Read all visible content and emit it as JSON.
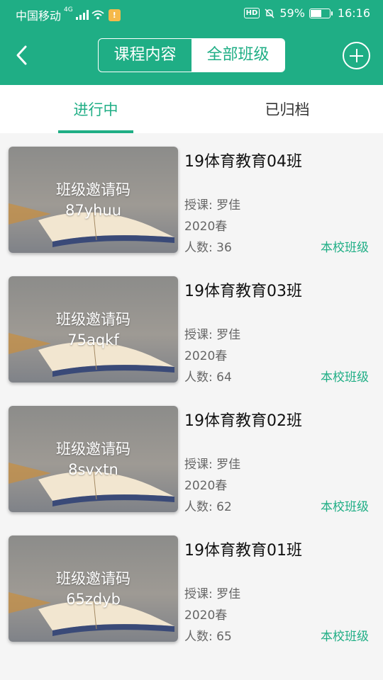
{
  "status_bar": {
    "carrier": "中国移动",
    "network": "4G",
    "battery": "59%",
    "battery_level": 0.59,
    "time": "16:16",
    "hd_badge": "HD"
  },
  "header": {
    "segments": [
      {
        "label": "课程内容",
        "active": false
      },
      {
        "label": "全部班级",
        "active": true
      }
    ]
  },
  "tabs": [
    {
      "label": "进行中",
      "active": true
    },
    {
      "label": "已归档",
      "active": false
    }
  ],
  "classes": [
    {
      "cover_label": "班级邀请码",
      "invite_code": "87yhuu",
      "name": "19体育教育04班",
      "teacher": "授课: 罗佳",
      "term": "2020春",
      "count": "人数: 36",
      "tag": "本校班级"
    },
    {
      "cover_label": "班级邀请码",
      "invite_code": "75aqkf",
      "name": "19体育教育03班",
      "teacher": "授课: 罗佳",
      "term": "2020春",
      "count": "人数: 64",
      "tag": "本校班级"
    },
    {
      "cover_label": "班级邀请码",
      "invite_code": "8svxtn",
      "name": "19体育教育02班",
      "teacher": "授课: 罗佳",
      "term": "2020春",
      "count": "人数: 62",
      "tag": "本校班级"
    },
    {
      "cover_label": "班级邀请码",
      "invite_code": "65zdyb",
      "name": "19体育教育01班",
      "teacher": "授课: 罗佳",
      "term": "2020春",
      "count": "人数: 65",
      "tag": "本校班级"
    }
  ],
  "colors": {
    "primary": "#1fae85",
    "background": "#f5f5f5"
  }
}
